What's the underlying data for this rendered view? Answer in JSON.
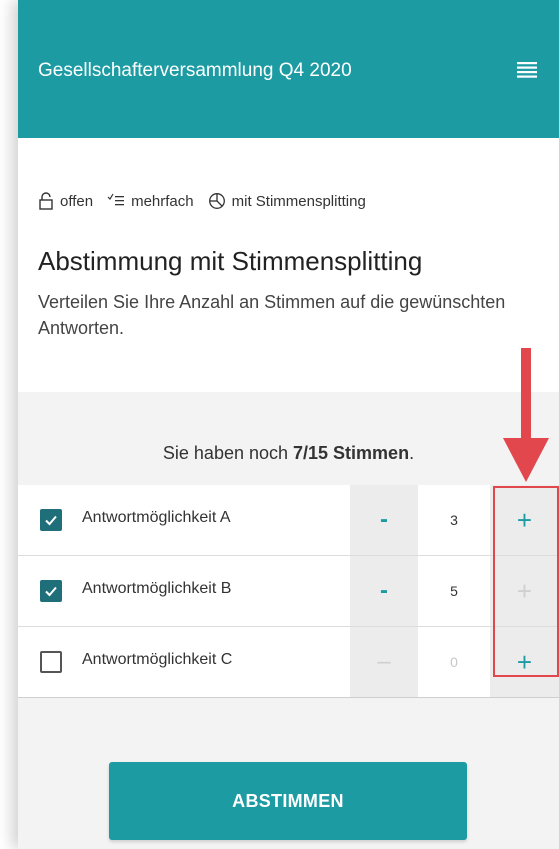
{
  "header": {
    "title": "Gesellschafterversammlung Q4 2020",
    "menu_icon": "hamburger-menu-icon",
    "color": "#1c9ba3"
  },
  "meta": [
    {
      "icon": "lock-open-icon",
      "label": "offen"
    },
    {
      "icon": "multi-select-list-icon",
      "label": "mehrfach"
    },
    {
      "icon": "vote-split-icon",
      "label": "mit Stimmensplitting"
    }
  ],
  "poll": {
    "title": "Abstimmung mit Stimmensplitting",
    "description": "Verteilen Sie Ihre Anzahl an Stimmen auf die gewünschten Antworten."
  },
  "remaining": {
    "prefix": "Sie haben noch ",
    "value": "7/15 Stimmen",
    "suffix": "."
  },
  "options": [
    {
      "label": "Antwortmöglichkeit A",
      "checked": true,
      "count": "3",
      "minus_label": "-",
      "plus_label": "+",
      "minus_enabled": true,
      "plus_enabled": true
    },
    {
      "label": "Antwortmöglichkeit B",
      "checked": true,
      "count": "5",
      "minus_label": "-",
      "plus_label": "+",
      "minus_enabled": true,
      "plus_enabled": false
    },
    {
      "label": "Antwortmöglichkeit C",
      "checked": false,
      "count": "0",
      "minus_label": "–",
      "plus_label": "+",
      "minus_enabled": false,
      "plus_enabled": true
    }
  ],
  "submit_label": "ABSTIMMEN",
  "annotation": {
    "color": "#e2474d"
  }
}
